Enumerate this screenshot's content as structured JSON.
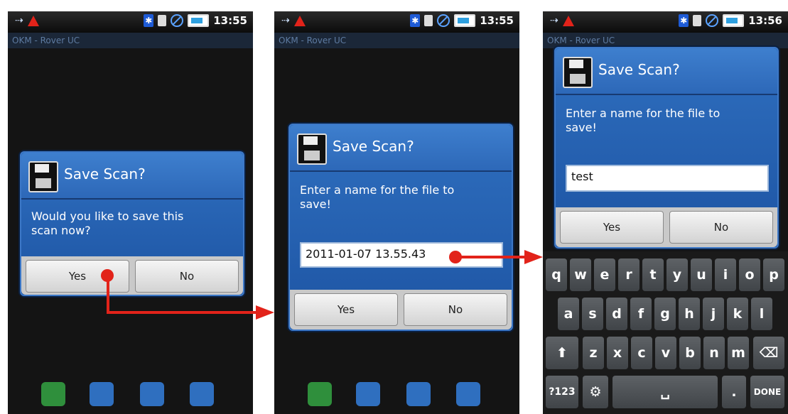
{
  "status": {
    "time_1": "13:55",
    "time_2": "13:55",
    "time_3": "13:56",
    "bt": "✱"
  },
  "app_title": "OKM - Rover UC",
  "screen1": {
    "dialog_title": "Save Scan?",
    "message": "Would you like to save this scan now?",
    "yes": "Yes",
    "no": "No"
  },
  "screen2": {
    "dialog_title": "Save Scan?",
    "message": "Enter a name for the file to save!",
    "input_value": "2011-01-07 13.55.43",
    "yes": "Yes",
    "no": "No"
  },
  "screen3": {
    "dialog_title": "Save Scan?",
    "message": "Enter a name for the file to save!",
    "input_value": "test",
    "yes": "Yes",
    "no": "No"
  },
  "toolbar_icons": [
    "move-icon",
    "rotate-icon",
    "zoom-in-icon",
    "eye-icon"
  ],
  "keyboard": {
    "row1": [
      "q",
      "w",
      "e",
      "r",
      "t",
      "y",
      "u",
      "i",
      "o",
      "p"
    ],
    "row2": [
      "a",
      "s",
      "d",
      "f",
      "g",
      "h",
      "j",
      "k",
      "l"
    ],
    "row3": [
      "z",
      "x",
      "c",
      "v",
      "b",
      "n",
      "m"
    ],
    "shift": "⬆",
    "backspace": "⌫",
    "num": "?123",
    "settings": "⚙",
    "space": "␣",
    "period": ".",
    "done": "DONE"
  },
  "colors": {
    "accent": "#2f6fbf",
    "arrow": "#e2231a"
  }
}
